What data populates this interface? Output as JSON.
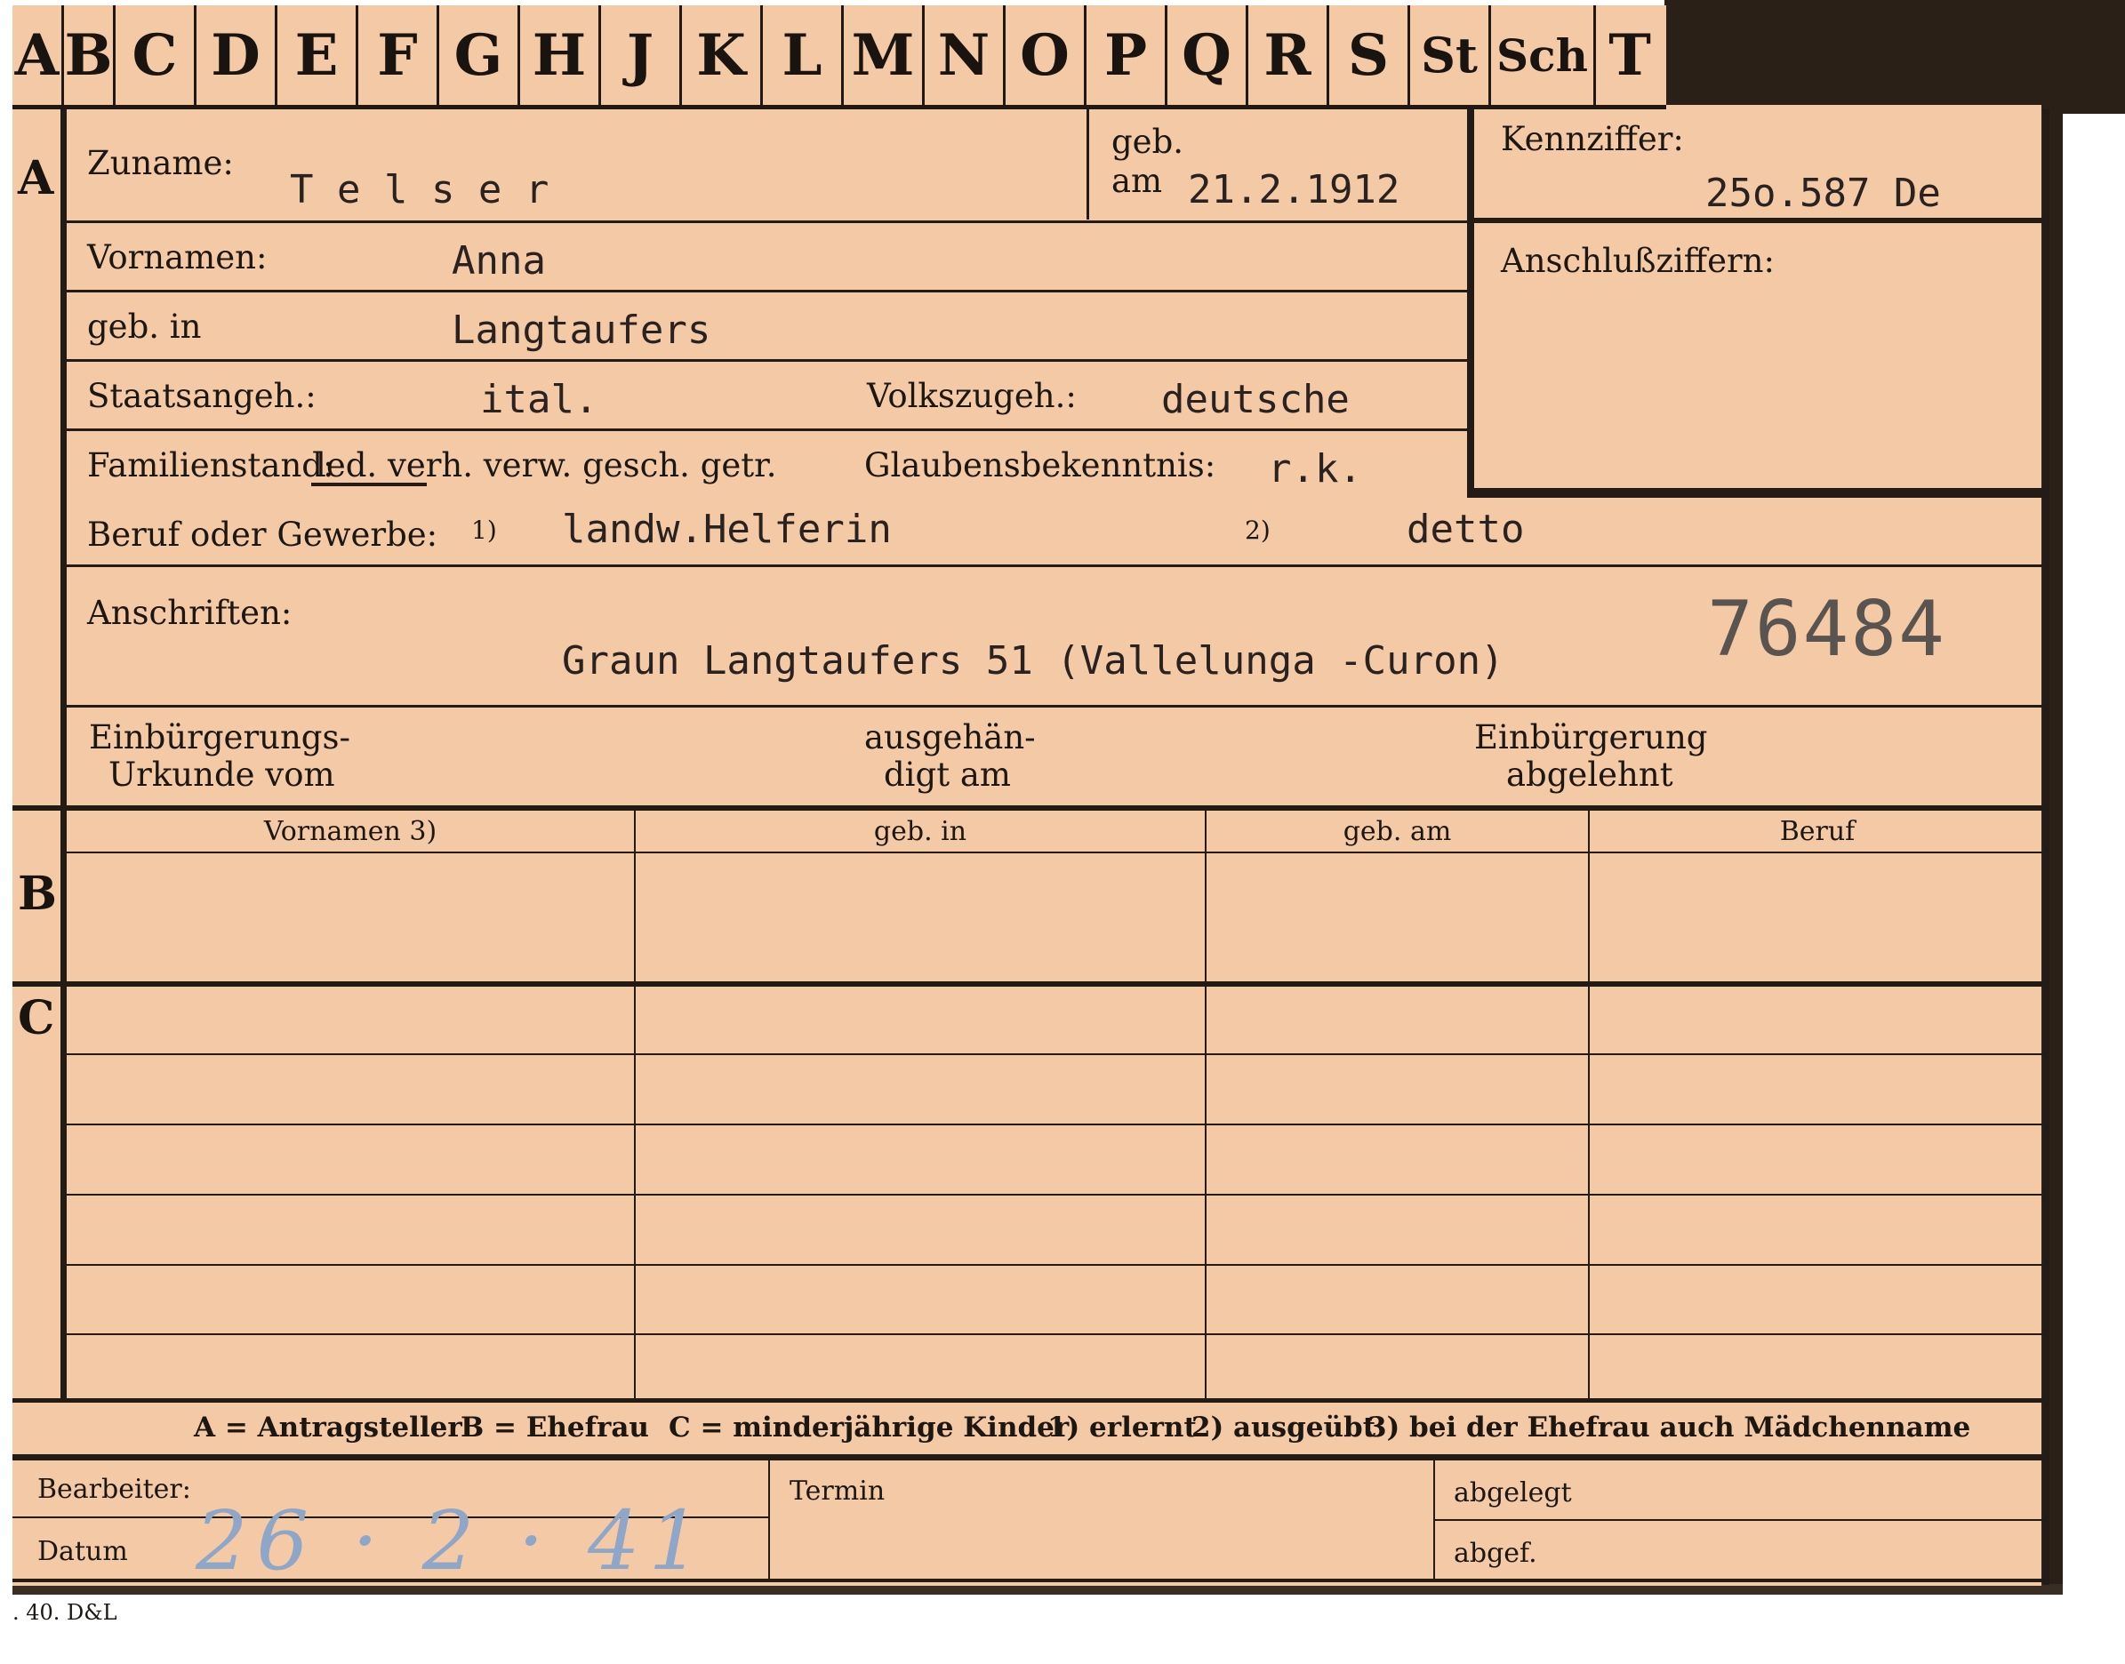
{
  "colors": {
    "card": "#f4c9a6",
    "ink": "#1d1712",
    "typewriter": "#2a2220",
    "pencil": "#8ea6c8"
  },
  "tabs": [
    "A",
    "B",
    "C",
    "D",
    "E",
    "F",
    "G",
    "H",
    "J",
    "K",
    "L",
    "M",
    "N",
    "O",
    "P",
    "Q",
    "R",
    "S",
    "St",
    "Sch",
    "T"
  ],
  "sections": {
    "a": "A",
    "b": "B",
    "c": "C"
  },
  "header": {
    "surname_label": "Zuname:",
    "surname_value": "T e l s e r",
    "born_label_1": "geb.",
    "born_label_2": "am",
    "born_value": "21.2.1912",
    "code_label": "Kennziffer:",
    "code_value": "25o.587  De",
    "linked_codes_label": "Anschlußziffern:"
  },
  "rows": {
    "first_names_label": "Vornamen:",
    "first_names_value": "Anna",
    "birthplace_label": "geb. in",
    "birthplace_value": "Langtaufers",
    "citizenship_label": "Staatsangeh.:",
    "citizenship_value": "ital.",
    "ethnicity_label": "Volkszugeh.:",
    "ethnicity_value": "deutsche",
    "marital_label": "Familienstand:",
    "marital_options": "led. verh. verw. gesch. getr.",
    "religion_label": "Glaubensbekenntnis:",
    "religion_value": "r.k.",
    "occupation_label": "Beruf oder Gewerbe:",
    "occ_mark_1": "1)",
    "occupation_value_1": "landw.Helferin",
    "occ_mark_2": "2)",
    "occupation_value_2": "detto",
    "address_label": "Anschriften:",
    "address_value": "Graun Langtaufers 51 (Vallelunga -Curon)",
    "stamp_number": "76484",
    "naturalization_doc_1": "Einbürgerungs-",
    "naturalization_doc_2": "Urkunde vom",
    "handed_1": "ausgehän-",
    "handed_2": "digt am",
    "rejected_1": "Einbürgerung",
    "rejected_2": "abgelehnt"
  },
  "table_headers": [
    "Vornamen 3)",
    "geb. in",
    "geb. am",
    "Beruf"
  ],
  "legend": {
    "a": "A = Antragsteller",
    "b": "B = Ehefrau",
    "c": "C = minderjährige Kinder",
    "n1": "1) erlernt",
    "n2": "2) ausgeübt",
    "n3": "3) bei der Ehefrau auch Mädchenname"
  },
  "footer": {
    "clerk_label": "Bearbeiter:",
    "date_label": "Datum",
    "date_value": "26 · 2 · 41",
    "deadline_label": "Termin",
    "filed_label": "abgelegt",
    "sent_label": "abgef.",
    "print_code": ". 40. D&L"
  }
}
